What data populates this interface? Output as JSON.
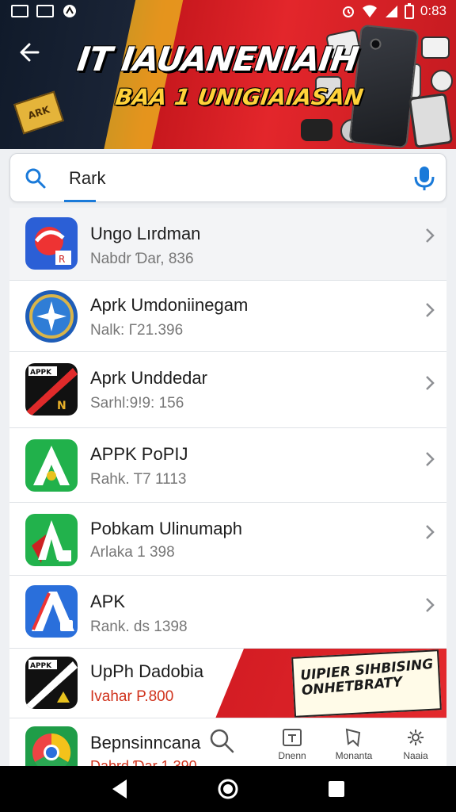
{
  "status_bar": {
    "time": "0:83"
  },
  "banner": {
    "title_line1": "IT IAUANENIAIH",
    "title_line2": "BAA 1 UNIGIAIASAN",
    "badge": "ARK"
  },
  "search": {
    "value": "Rark"
  },
  "apps": [
    {
      "name": "Ungo Lırdman",
      "meta": "Nabdr Ɗar, 836"
    },
    {
      "name": "Aprk Umdoniinegam",
      "meta": "Nalk: Γ21.396"
    },
    {
      "name": "Aprk Unddedar",
      "meta": "Sarhl:9!9: 156"
    },
    {
      "name": "APPK PoPIJ",
      "meta": "Rahk. T7 1113"
    },
    {
      "name": "Pobkam Ulinumaph",
      "meta": "Arlaka 1 398"
    },
    {
      "name": "APK",
      "meta": "Rank. ds 1398"
    }
  ],
  "promo_app": {
    "name": "UpPh Dadobia",
    "meta": "Ivahar P.800",
    "banner_line1": "UIPIER SIHBISING",
    "banner_line2": "ONHETBRATY"
  },
  "last_app": {
    "name": "Bepnsinncana",
    "meta": "Dabrd Ɗar 1 390"
  },
  "bottom_tabs": [
    {
      "label": "Dnenn"
    },
    {
      "label": "Monanta"
    },
    {
      "label": "Naaia"
    }
  ],
  "colors": {
    "accent": "#1a7ad9",
    "banner_red": "#e3262b",
    "price_red": "#d0321c"
  }
}
